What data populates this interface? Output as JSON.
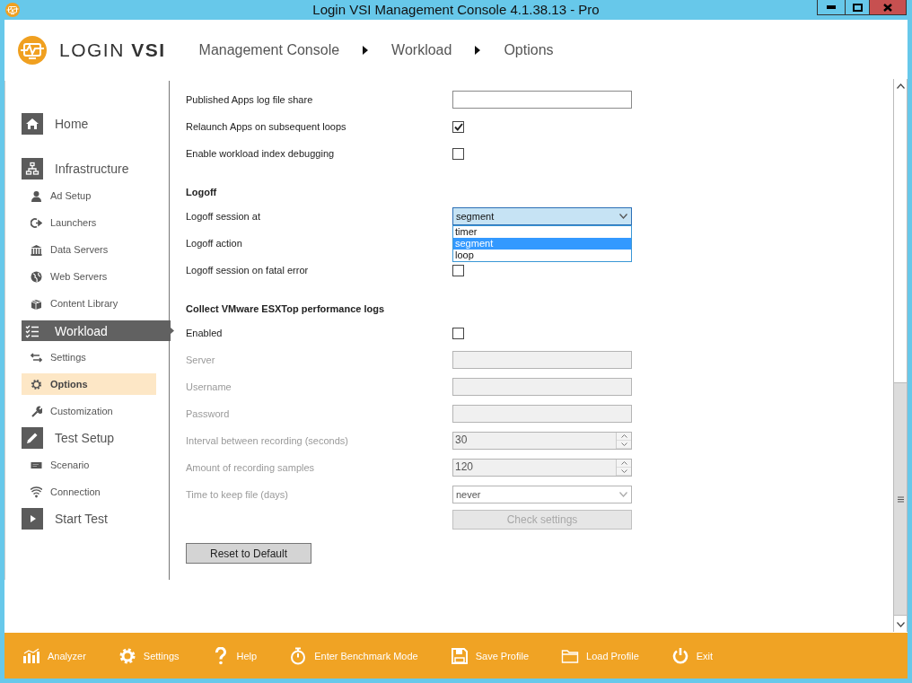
{
  "window": {
    "title": "Login VSI Management Console 4.1.38.13 - Pro"
  },
  "header": {
    "logo": "LOGIN **VSI**",
    "breadcrumb": [
      "Management Console",
      "Workload",
      "Options"
    ]
  },
  "sidebar": {
    "items": [
      {
        "label": "Home",
        "selected": false
      },
      {
        "label": "Infrastructure",
        "selected": false,
        "children": [
          {
            "label": "Ad Setup",
            "selected": false
          },
          {
            "label": "Launchers",
            "selected": false
          },
          {
            "label": "Data Servers",
            "selected": false
          },
          {
            "label": "Web Servers",
            "selected": false
          },
          {
            "label": "Content Library",
            "selected": false
          }
        ]
      },
      {
        "label": "Workload",
        "selected": true,
        "children": [
          {
            "label": "Settings",
            "selected": false
          },
          {
            "label": "Options",
            "selected": true
          },
          {
            "label": "Customization",
            "selected": false
          }
        ]
      },
      {
        "label": "Test Setup",
        "selected": false,
        "children": [
          {
            "label": "Scenario",
            "selected": false
          },
          {
            "label": "Connection",
            "selected": false
          }
        ]
      },
      {
        "label": "Start Test",
        "selected": false
      }
    ]
  },
  "settings": {
    "rows": [
      {
        "kind": "text",
        "label": "Published Apps log file share",
        "disabled": false
      },
      {
        "kind": "checkbox",
        "label": "Relaunch Apps on subsequent loops",
        "checked": true,
        "disabled": false
      },
      {
        "kind": "checkbox",
        "label": "Enable workload index debugging",
        "checked": false,
        "disabled": false
      },
      {
        "kind": "heading",
        "label": "Logoff"
      },
      {
        "kind": "dropdown",
        "label": "Logoff session at",
        "value": "segment",
        "expanded": true,
        "disabled": false,
        "options": [
          {
            "label": "timer",
            "selected": false
          },
          {
            "label": "segment",
            "selected": true
          },
          {
            "label": "loop",
            "selected": false
          }
        ]
      },
      {
        "kind": "plain",
        "label": "Logoff action",
        "disabled": false
      },
      {
        "kind": "checkbox",
        "label": "Logoff session on fatal error",
        "checked": false,
        "disabled": false
      },
      {
        "kind": "heading",
        "label": "Collect VMware ESXTop performance logs"
      },
      {
        "kind": "checkbox",
        "label": "Enabled",
        "checked": false,
        "disabled": false
      },
      {
        "kind": "text",
        "label": "Server",
        "disabled": true
      },
      {
        "kind": "text",
        "label": "Username",
        "disabled": true
      },
      {
        "kind": "text",
        "label": "Password",
        "disabled": true
      },
      {
        "kind": "spin",
        "label": "Interval between recording (seconds)",
        "value": "30",
        "disabled": true
      },
      {
        "kind": "spin",
        "label": "Amount of recording samples",
        "value": "120",
        "disabled": true
      },
      {
        "kind": "dropdown",
        "label": "Time to keep file (days)",
        "value": "never",
        "expanded": false,
        "disabled": true
      },
      {
        "kind": "action",
        "button": "Check settings",
        "disabled": true
      }
    ],
    "reset_button": "Reset to Default"
  },
  "footer": {
    "items": [
      "Analyzer",
      "Settings",
      "Help",
      "Enter Benchmark Mode",
      "Save Profile",
      "Load Profile",
      "Exit"
    ]
  }
}
